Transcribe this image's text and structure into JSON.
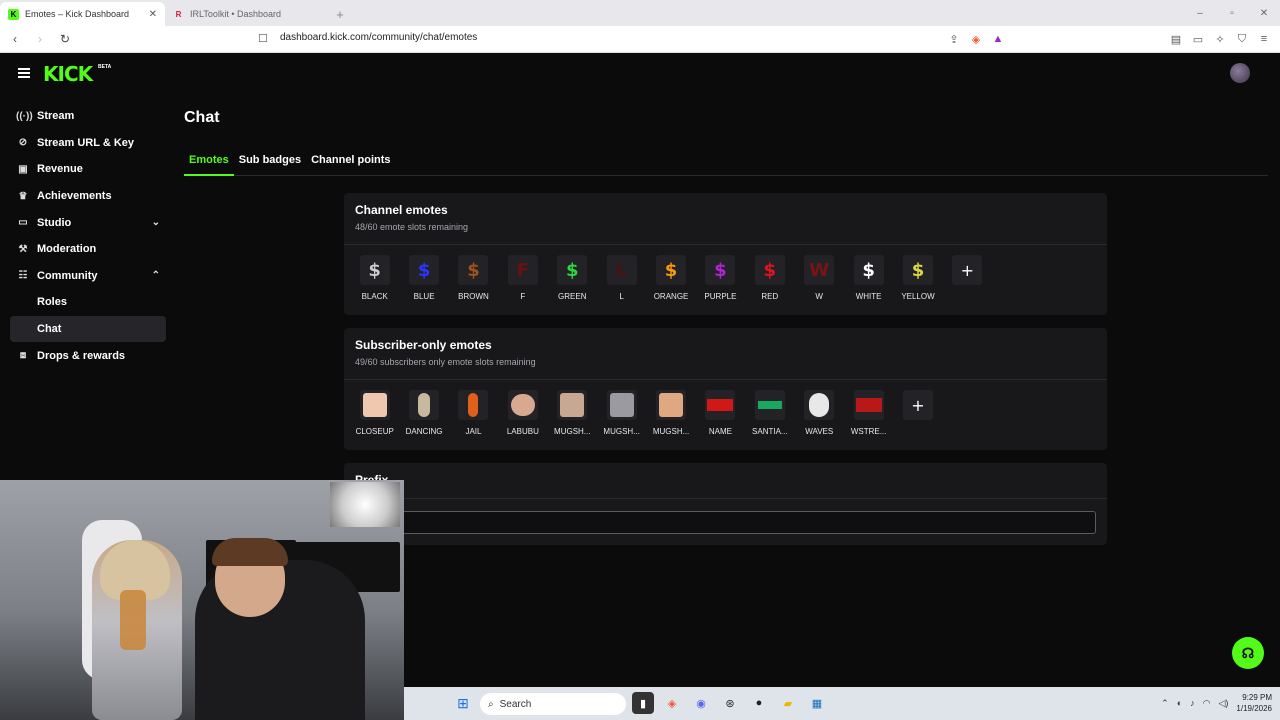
{
  "browser": {
    "tabs": [
      {
        "title": "Emotes – Kick Dashboard",
        "active": true
      },
      {
        "title": "IRLToolkit • Dashboard",
        "active": false
      }
    ],
    "url": "dashboard.kick.com/community/chat/emotes"
  },
  "app": {
    "logo": "KICK",
    "logo_badge": "BETA",
    "accent": "#53fc18"
  },
  "sidebar": {
    "items": [
      {
        "label": "Stream",
        "icon": "broadcast-icon"
      },
      {
        "label": "Stream URL & Key",
        "icon": "link-icon"
      },
      {
        "label": "Revenue",
        "icon": "dollar-icon"
      },
      {
        "label": "Achievements",
        "icon": "trophy-icon"
      },
      {
        "label": "Studio",
        "icon": "studio-icon",
        "chevron": "down"
      },
      {
        "label": "Moderation",
        "icon": "hammer-icon"
      },
      {
        "label": "Community",
        "icon": "community-icon",
        "chevron": "up"
      },
      {
        "label": "Roles",
        "sub": true
      },
      {
        "label": "Chat",
        "sub": true,
        "selected": true
      },
      {
        "label": "Drops & rewards",
        "icon": "gift-icon"
      }
    ]
  },
  "main": {
    "title": "Chat",
    "tabs": [
      {
        "label": "Emotes",
        "active": true
      },
      {
        "label": "Sub badges"
      },
      {
        "label": "Channel points"
      }
    ]
  },
  "channel_emotes": {
    "title": "Channel emotes",
    "subtitle": "48/60 emote slots remaining",
    "emotes": [
      {
        "label": "BLACK",
        "glyph": "$",
        "color": "#cccccc"
      },
      {
        "label": "BLUE",
        "glyph": "$",
        "color": "#2a35ff"
      },
      {
        "label": "BROWN",
        "glyph": "$",
        "color": "#a0521d"
      },
      {
        "label": "F",
        "glyph": "F",
        "color": "#6b1010"
      },
      {
        "label": "GREEN",
        "glyph": "$",
        "color": "#2bd640"
      },
      {
        "label": "L",
        "glyph": "L",
        "color": "#4a1212"
      },
      {
        "label": "ORANGE",
        "glyph": "$",
        "color": "#f59a0c"
      },
      {
        "label": "PURPLE",
        "glyph": "$",
        "color": "#b323d6"
      },
      {
        "label": "RED",
        "glyph": "$",
        "color": "#e0141c"
      },
      {
        "label": "W",
        "glyph": "W",
        "color": "#7a1414"
      },
      {
        "label": "WHITE",
        "glyph": "$",
        "color": "#ffffff"
      },
      {
        "label": "YELLOW",
        "glyph": "$",
        "color": "#d8d840"
      }
    ]
  },
  "subscriber_emotes": {
    "title": "Subscriber-only emotes",
    "subtitle": "49/60 subscribers only emote slots remaining",
    "emotes": [
      {
        "label": "CLOSEUP",
        "color": "#f0c8b0"
      },
      {
        "label": "DANCING",
        "color": "#c8b8a0"
      },
      {
        "label": "JAIL",
        "color": "#e0601a"
      },
      {
        "label": "LABUBU",
        "color": "#d8a890"
      },
      {
        "label": "MUGSH...",
        "color": "#c8a890"
      },
      {
        "label": "MUGSH...",
        "color": "#9a9aa0"
      },
      {
        "label": "MUGSH...",
        "color": "#e0a880"
      },
      {
        "label": "NAME",
        "color": "#d01818"
      },
      {
        "label": "SANTIA...",
        "color": "#18a860"
      },
      {
        "label": "WAVES",
        "color": "#e8e8e8"
      },
      {
        "label": "WSTRE...",
        "color": "#b81818"
      }
    ]
  },
  "prefix_card": {
    "title": "Prefix"
  },
  "add_label": "+",
  "taskbar": {
    "search_placeholder": "Search",
    "time": "9:29 PM",
    "date": "1/19/2026"
  }
}
